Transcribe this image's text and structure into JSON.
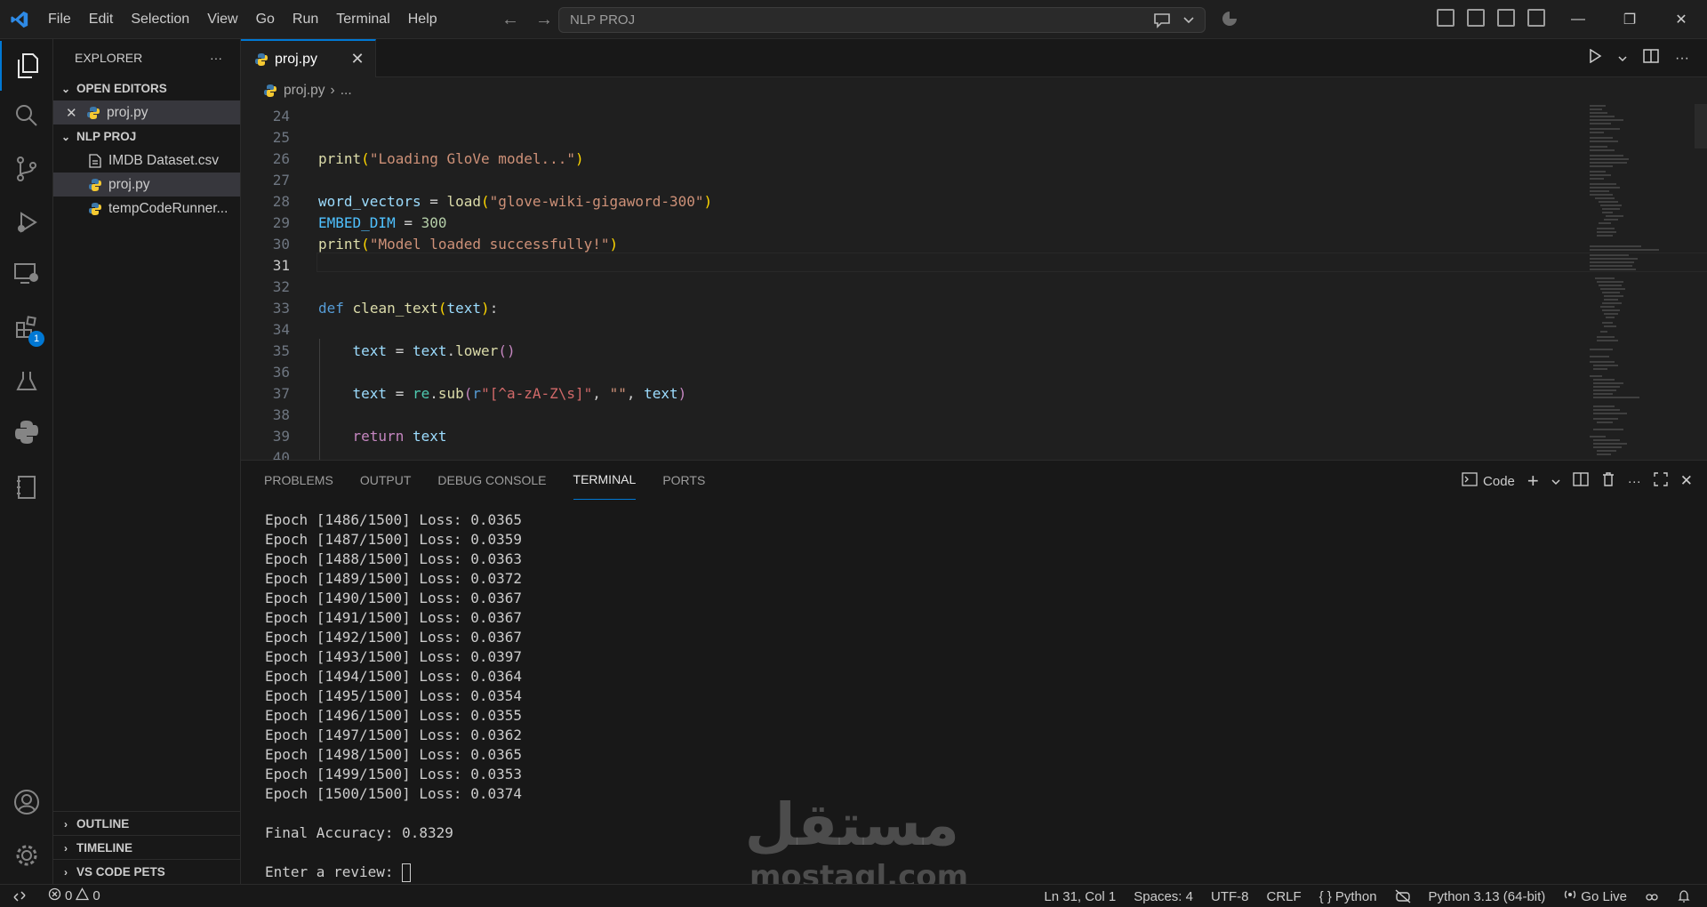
{
  "menu": [
    "File",
    "Edit",
    "Selection",
    "View",
    "Go",
    "Run",
    "Terminal",
    "Help"
  ],
  "command_center": {
    "text": "NLP PROJ"
  },
  "sidebar": {
    "title": "EXPLORER",
    "open_editors_label": "OPEN EDITORS",
    "open_editor_file": "proj.py",
    "project_label": "NLP PROJ",
    "files": [
      "IMDB Dataset.csv",
      "proj.py",
      "tempCodeRunner..."
    ],
    "bottom_sections": [
      "OUTLINE",
      "TIMELINE",
      "VS CODE PETS"
    ]
  },
  "activity_badge": "1",
  "tab": {
    "label": "proj.py"
  },
  "breadcrumb": {
    "file": "proj.py",
    "rest": "..."
  },
  "code_lines": [
    {
      "n": "24",
      "code": ""
    },
    {
      "n": "25",
      "code": ""
    },
    {
      "n": "26",
      "code": "print(\"Loading GloVe model...\")"
    },
    {
      "n": "27",
      "code": ""
    },
    {
      "n": "28",
      "code": "word_vectors = load(\"glove-wiki-gigaword-300\")"
    },
    {
      "n": "29",
      "code": "EMBED_DIM = 300"
    },
    {
      "n": "30",
      "code": "print(\"Model loaded successfully!\")"
    },
    {
      "n": "31",
      "code": ""
    },
    {
      "n": "32",
      "code": ""
    },
    {
      "n": "33",
      "code": "def clean_text(text):"
    },
    {
      "n": "34",
      "code": ""
    },
    {
      "n": "35",
      "code": "    text = text.lower()"
    },
    {
      "n": "36",
      "code": ""
    },
    {
      "n": "37",
      "code": "    text = re.sub(r\"[^a-zA-Z\\s]\", \"\", text)"
    },
    {
      "n": "38",
      "code": ""
    },
    {
      "n": "39",
      "code": "    return text"
    },
    {
      "n": "40",
      "code": ""
    }
  ],
  "panel": {
    "tabs": [
      "PROBLEMS",
      "OUTPUT",
      "DEBUG CONSOLE",
      "TERMINAL",
      "PORTS"
    ],
    "active_tab": "TERMINAL",
    "terminal_profile": "Code"
  },
  "terminal_lines": [
    "Epoch [1486/1500] Loss: 0.0365",
    "Epoch [1487/1500] Loss: 0.0359",
    "Epoch [1488/1500] Loss: 0.0363",
    "Epoch [1489/1500] Loss: 0.0372",
    "Epoch [1490/1500] Loss: 0.0367",
    "Epoch [1491/1500] Loss: 0.0367",
    "Epoch [1492/1500] Loss: 0.0367",
    "Epoch [1493/1500] Loss: 0.0397",
    "Epoch [1494/1500] Loss: 0.0364",
    "Epoch [1495/1500] Loss: 0.0354",
    "Epoch [1496/1500] Loss: 0.0355",
    "Epoch [1497/1500] Loss: 0.0362",
    "Epoch [1498/1500] Loss: 0.0365",
    "Epoch [1499/1500] Loss: 0.0353",
    "Epoch [1500/1500] Loss: 0.0374",
    "",
    "Final Accuracy: 0.8329",
    ""
  ],
  "terminal_prompt": "Enter a review: ",
  "watermark": {
    "arabic": "مستقل",
    "latin": "mostaql.com"
  },
  "statusbar": {
    "errors": "0",
    "warnings": "0",
    "position": "Ln 31, Col 1",
    "spaces": "Spaces: 4",
    "encoding": "UTF-8",
    "eol": "CRLF",
    "language": "Python",
    "interpreter": "Python 3.13 (64-bit)",
    "live": "Go Live"
  },
  "colors": {
    "accent": "#0078d4",
    "background": "#1f1f1f",
    "sidebar": "#181818"
  }
}
